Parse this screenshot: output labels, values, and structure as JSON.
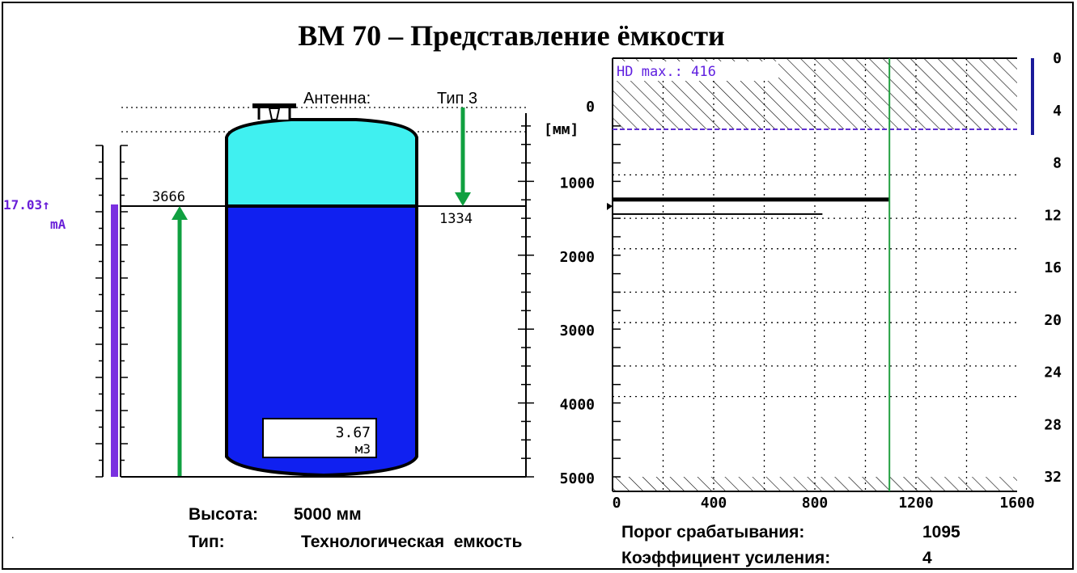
{
  "title": "BM 70 – Представление ёмкости",
  "antenna": {
    "label": "Антенна:",
    "type": "Тип 3"
  },
  "current": {
    "value": "17.03↑",
    "unit": "mA"
  },
  "level_label": "3666",
  "distance_label": "1334",
  "volume": {
    "value": "3.67",
    "unit": "м3"
  },
  "depth_axis": {
    "unit": "[мм]",
    "ticks": [
      "0",
      "1000",
      "2000",
      "3000",
      "4000",
      "5000"
    ]
  },
  "info_left": {
    "height_label": "Высота:",
    "height_value": "5000 мм",
    "type_label": "Тип:",
    "type_value": "Технологическая  емкость"
  },
  "info_right": {
    "threshold_label": "Порог срабатывания:",
    "threshold_value": "1095",
    "gain_label": "Коэффициент усиления:",
    "gain_value": "4"
  },
  "chart_data": {
    "type": "echo-curve",
    "annotation": "HD max.: 416",
    "x_ticks": [
      "0",
      "400",
      "800",
      "1200",
      "1600"
    ],
    "xlim": [
      0,
      1600
    ],
    "right_ticks": [
      "0",
      "4",
      "8",
      "12",
      "16",
      "20",
      "24",
      "28",
      "32"
    ],
    "right_lim": [
      0,
      32
    ],
    "depth_lim": [
      0,
      5000
    ],
    "hd_max": 416,
    "threshold": 1095,
    "echo_depth": 1334,
    "echo_amplitude": 1095,
    "secondary_echo_amplitude": 830,
    "colors": {
      "threshold_line": "#22a040",
      "hd_line": "#6030d0",
      "liquid": "#1020f0",
      "gas": "#40f0f0",
      "current_bar": "#7a30e0",
      "arrow": "#10a040"
    }
  }
}
